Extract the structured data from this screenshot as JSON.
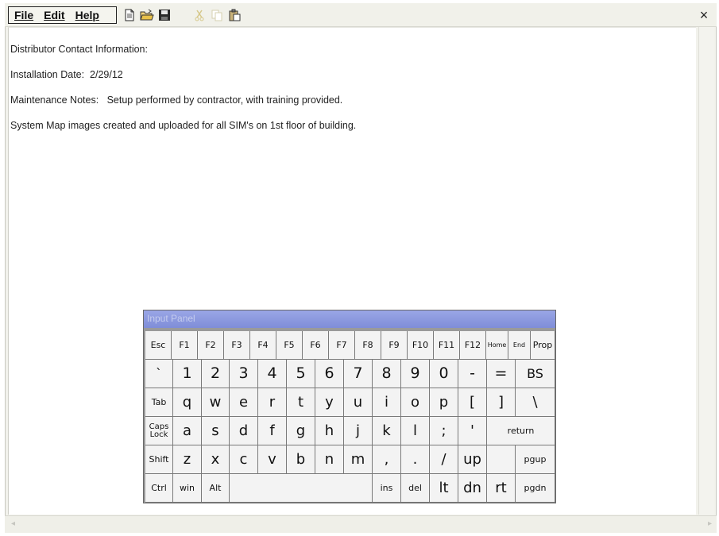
{
  "menubar": {
    "items": [
      "File",
      "Edit",
      "Help"
    ]
  },
  "toolbar": {
    "icons": [
      "new-icon",
      "open-icon",
      "save-icon",
      "cut-icon",
      "copy-icon",
      "paste-icon"
    ]
  },
  "window": {
    "close_label": "×"
  },
  "content": {
    "lines": [
      "Distributor Contact Information:",
      "Installation Date:  2/29/12",
      "Maintenance Notes:   Setup performed by contractor, with training provided.",
      "System Map images created and uploaded for all SIM's on 1st floor of building."
    ]
  },
  "keyboard": {
    "title": "Input Panel",
    "rows": [
      [
        "Esc",
        "F1",
        "F2",
        "F3",
        "F4",
        "F5",
        "F6",
        "F7",
        "F8",
        "F9",
        "F10",
        "F11",
        "F12",
        "Home",
        "End",
        "Prop"
      ],
      [
        "`",
        "1",
        "2",
        "3",
        "4",
        "5",
        "6",
        "7",
        "8",
        "9",
        "0",
        "-",
        "=",
        "BS"
      ],
      [
        "Tab",
        "q",
        "w",
        "e",
        "r",
        "t",
        "y",
        "u",
        "i",
        "o",
        "p",
        "[",
        "]",
        "\\"
      ],
      [
        "Caps Lock",
        "a",
        "s",
        "d",
        "f",
        "g",
        "h",
        "j",
        "k",
        "l",
        ";",
        "'",
        "return"
      ],
      [
        "Shift",
        "z",
        "x",
        "c",
        "v",
        "b",
        "n",
        "m",
        ",",
        ".",
        "/",
        "up",
        "",
        "pgup"
      ],
      [
        "Ctrl",
        "win",
        "Alt",
        "",
        "ins",
        "del",
        "lt",
        "dn",
        "rt",
        "pgdn"
      ]
    ]
  }
}
